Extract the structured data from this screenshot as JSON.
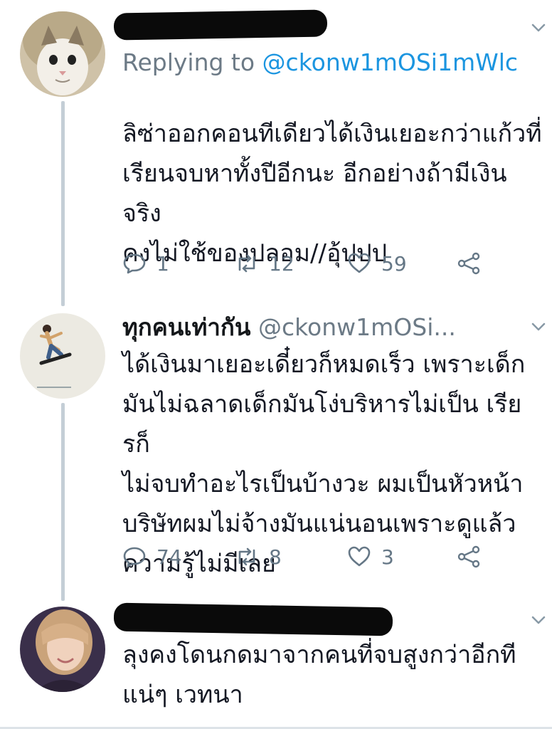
{
  "tweets": [
    {
      "reply_prefix": "Replying to ",
      "reply_to": "@ckonw1mOSi1mWlc",
      "text_lines": [
        "ลิซ่าออกคอนทีเดียวได้เงินเยอะกว่าแก้วที่",
        "เรียนจบหาทั้งปีอีกนะ อีกอย่างถ้ามีเงินจริง",
        "คงไม่ใช้ของปลอม//อุ้ปปป"
      ],
      "stats": {
        "replies": "1",
        "retweets": "12",
        "likes": "59"
      }
    },
    {
      "display_name": "ทุกคนเท่ากัน",
      "handle": "@ckonw1mOSi...",
      "text_lines": [
        "ได้เงินมาเยอะเดี๋ยวก็หมดเร็ว เพราะเด็ก",
        "มันไม่ฉลาดเด็กมันโง่บริหารไม่เป็น เรียรก็",
        "ไม่จบทำอะไรเป็นบ้างวะ ผมเป็นหัวหน้า",
        "บริษัทผมไม่จ้างมันแน่นอนเพราะดูแล้ว",
        "ความรู้ไม่มีเลย"
      ],
      "stats": {
        "replies": "74",
        "retweets": "8",
        "likes": "3"
      }
    },
    {
      "text_lines": [
        "ลุงคงโดนกดมาจากคนที่จบสูงกว่าอีกที",
        "แน่ๆ เวทนา"
      ]
    }
  ],
  "colors": {
    "accent": "#1b95e0",
    "muted": "#657786",
    "thread_line": "#c4ced6",
    "redaction": "#0a0a0a"
  },
  "icons": [
    "reply-icon",
    "retweet-icon",
    "like-icon",
    "share-icon",
    "chevron-down-icon"
  ]
}
